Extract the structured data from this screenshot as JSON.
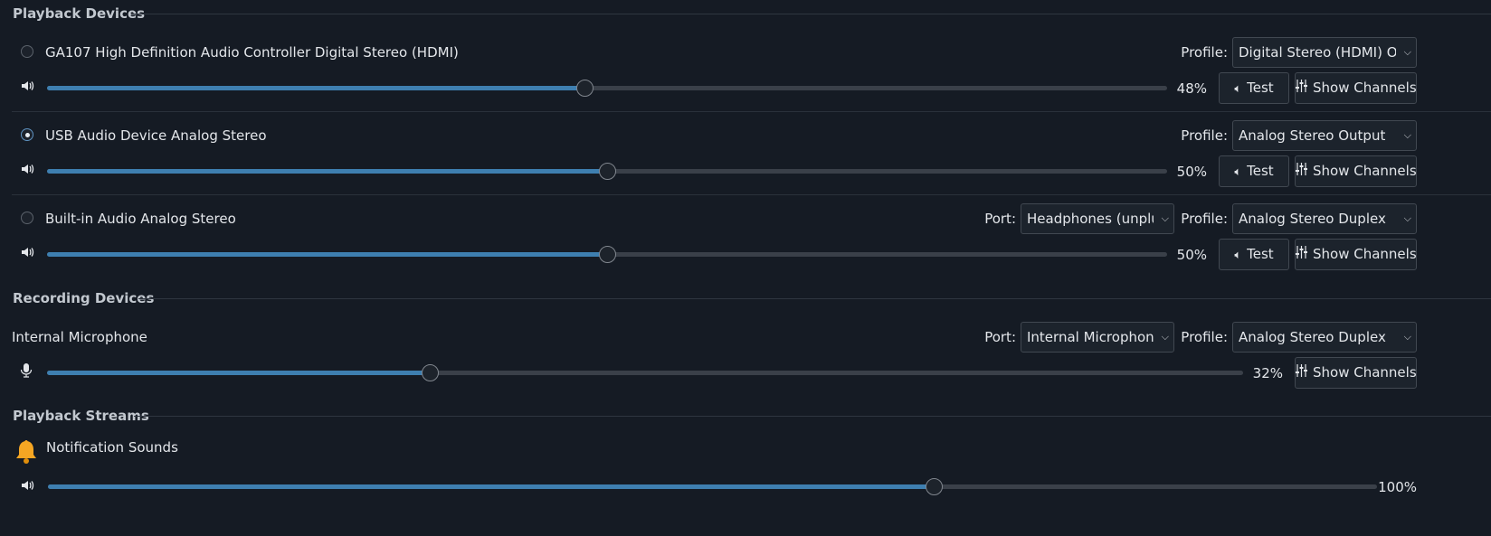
{
  "sections": {
    "playback_devices": "Playback Devices",
    "recording_devices": "Recording Devices",
    "playback_streams": "Playback Streams"
  },
  "labels": {
    "profile": "Profile:",
    "port": "Port:",
    "test": "Test",
    "show_channels": "Show Channels"
  },
  "playback_devices": [
    {
      "name": "GA107 High Definition Audio Controller Digital Stereo (HDMI)",
      "selected": false,
      "profile": "Digital Stereo (HDMI) Output",
      "volume_label": "48%",
      "volume": 0.48
    },
    {
      "name": "USB Audio Device Analog Stereo",
      "selected": true,
      "profile": "Analog Stereo Output",
      "volume_label": "50%",
      "volume": 0.5
    },
    {
      "name": "Built-in Audio Analog Stereo",
      "selected": false,
      "port": "Headphones (unplugged)",
      "profile": "Analog Stereo Duplex",
      "volume_label": "50%",
      "volume": 0.5
    }
  ],
  "recording_devices": [
    {
      "name": "Internal Microphone",
      "port": "Internal Microphone",
      "profile": "Analog Stereo Duplex",
      "volume_label": "32%",
      "volume": 0.32
    }
  ],
  "playback_streams": [
    {
      "name": "Notification Sounds",
      "icon": "bell-icon",
      "volume_label": "100%",
      "volume": 0.6667
    }
  ],
  "colors": {
    "background": "#151b24",
    "accent": "#3e7fb0",
    "track": "#3a4049",
    "bell": "#f5a623"
  }
}
